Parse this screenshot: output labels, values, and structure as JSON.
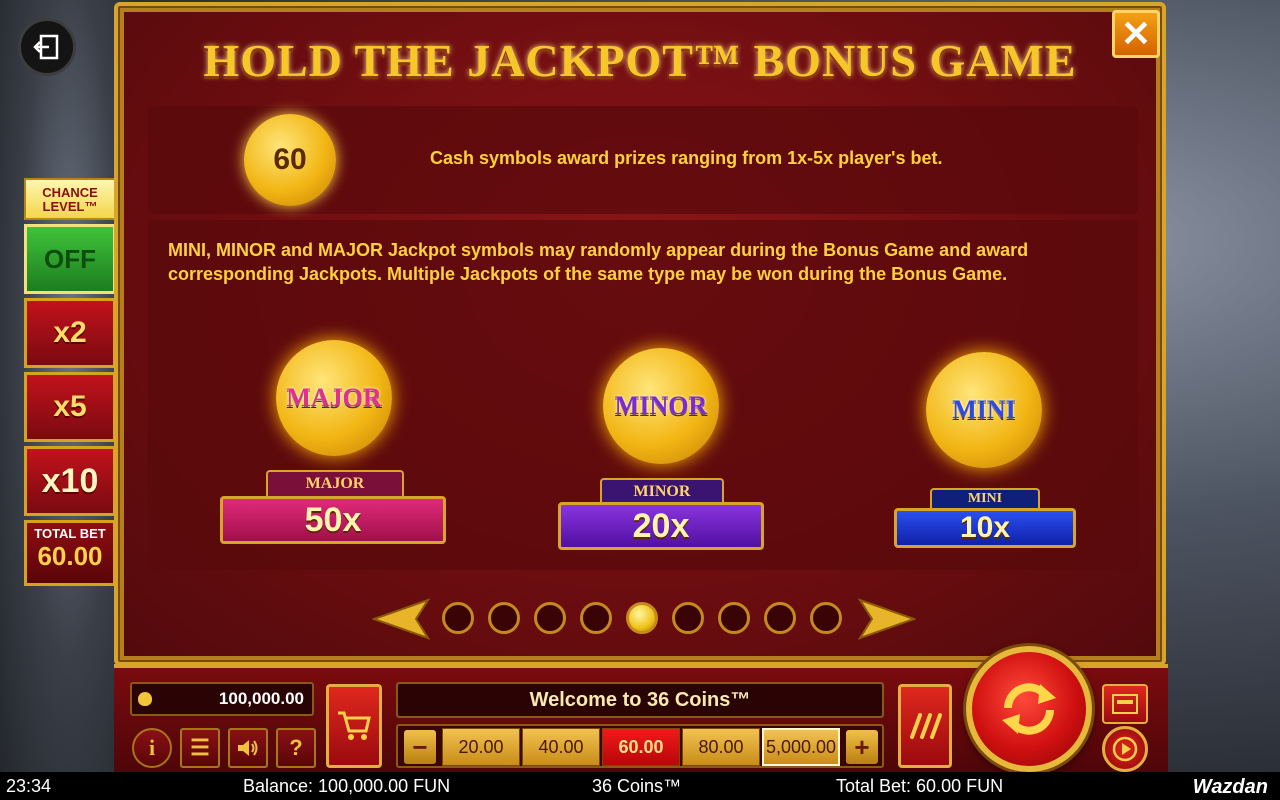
{
  "header": {
    "title": "HOLD THE JACKPOT™ BONUS GAME",
    "close_label": "✕"
  },
  "chance": {
    "title": "CHANCE LEVEL™",
    "options": [
      "OFF",
      "x2",
      "x5",
      "x10"
    ],
    "total_bet_label": "TOTAL BET",
    "total_bet_value": "60.00"
  },
  "cash": {
    "coin_value": "60",
    "text": "Cash symbols award prizes ranging from 1x-5x player's bet."
  },
  "jackpots": {
    "description": "MINI, MINOR and MAJOR Jackpot symbols may randomly appear during the Bonus Game and award corresponding Jackpots. Multiple Jackpots of the same type may be won during the Bonus Game.",
    "items": [
      {
        "coin_label": "MAJOR",
        "tab_label": "MAJOR",
        "value": "50x",
        "color": "#c2185b"
      },
      {
        "coin_label": "MINOR",
        "tab_label": "MINOR",
        "value": "20x",
        "color": "#6a1fb0"
      },
      {
        "coin_label": "MINI",
        "tab_label": "MINI",
        "value": "10x",
        "color": "#1530c0"
      }
    ]
  },
  "pager": {
    "total_pages": 9,
    "current_page": 5
  },
  "controls": {
    "balance": "100,000.00",
    "welcome": "Welcome to 36 Coins™",
    "bet_options": [
      "20.00",
      "40.00",
      "60.00",
      "80.00",
      "5,000.00"
    ],
    "selected_bet": "60.00",
    "minus": "−",
    "plus": "+",
    "info": "i",
    "menu": "☰",
    "sound": "🔊",
    "help": "?"
  },
  "status": {
    "time": "23:34",
    "balance": "Balance: 100,000.00 FUN",
    "game": "36 Coins™",
    "total_bet": "Total Bet: 60.00 FUN",
    "brand": "Wazdan"
  },
  "colors": {
    "accent_gold": "#d9a42a",
    "panel_red": "#6d0d10",
    "text_gold": "#ffd13a"
  }
}
